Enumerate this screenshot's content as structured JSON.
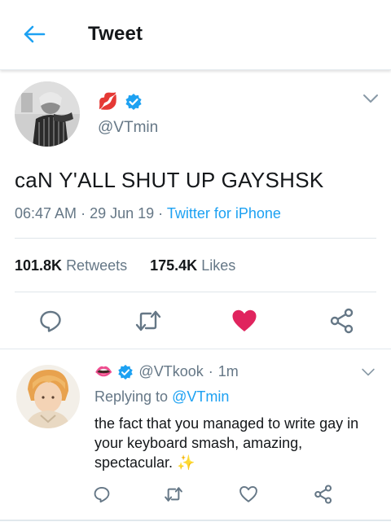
{
  "header": {
    "title": "Tweet",
    "back_icon": "arrow-left-icon",
    "accent_color": "#1da1f2"
  },
  "main_tweet": {
    "name_emoji": "💋",
    "verified_icon": "verified-badge-icon",
    "handle": "@VTmin",
    "text": "caN Y'ALL SHUT UP GAYSHSK",
    "time": "06:47 AM",
    "date": "29 Jun 19",
    "source": "Twitter for iPhone",
    "retweets_count": "101.8K",
    "retweets_label": "Retweets",
    "likes_count": "175.4K",
    "likes_label": "Likes",
    "liked": true,
    "like_color": "#e0245e",
    "actions": [
      "reply-icon",
      "retweet-icon",
      "heart-icon",
      "share-icon"
    ]
  },
  "reply_tweet": {
    "name_emoji": "👄",
    "verified_icon": "verified-badge-icon",
    "handle": "@VTkook",
    "age": "1m",
    "replying_prefix": "Replying to",
    "replying_to": "@VTmin",
    "text": "the fact that you managed to write gay in your keyboard smash, amazing, spectacular.",
    "trailing_emoji": "✨",
    "actions": [
      "reply-icon",
      "retweet-icon",
      "heart-outline-icon",
      "share-icon"
    ]
  }
}
